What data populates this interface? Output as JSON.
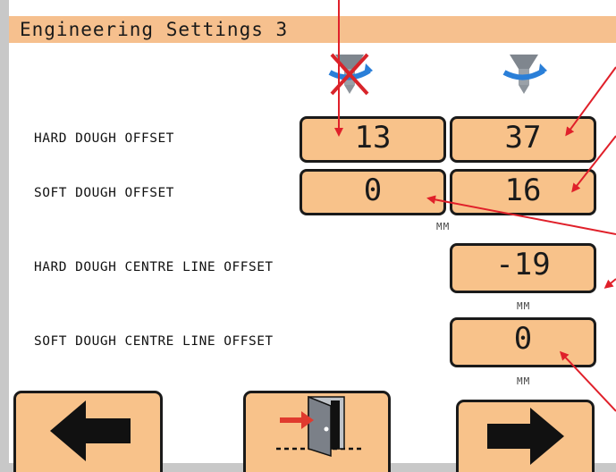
{
  "title": "Engineering Settings 3",
  "columns": [
    {
      "icon": "nozzle-disabled-icon"
    },
    {
      "icon": "nozzle-rotating-icon"
    }
  ],
  "rows": {
    "hard_offset": {
      "label": "HARD DOUGH OFFSET",
      "value_a": "13",
      "value_b": "37"
    },
    "soft_offset": {
      "label": "SOFT DOUGH OFFSET",
      "value_a": "0",
      "value_b": "16",
      "unit": "MM"
    },
    "hard_centre": {
      "label": "HARD DOUGH CENTRE LINE OFFSET",
      "value": "-19",
      "unit": "MM"
    },
    "soft_centre": {
      "label": "SOFT DOUGH CENTRE LINE OFFSET",
      "value": "0",
      "unit": "MM"
    }
  },
  "nav": {
    "back_icon": "arrow-left-icon",
    "exit_icon": "exit-door-icon",
    "next_icon": "arrow-right-icon"
  },
  "colors": {
    "button_fill": "#f8c28a",
    "title_bar": "#f6c08e",
    "annotation_arrow": "#e0202a",
    "icon_blue": "#2a7fd8"
  }
}
